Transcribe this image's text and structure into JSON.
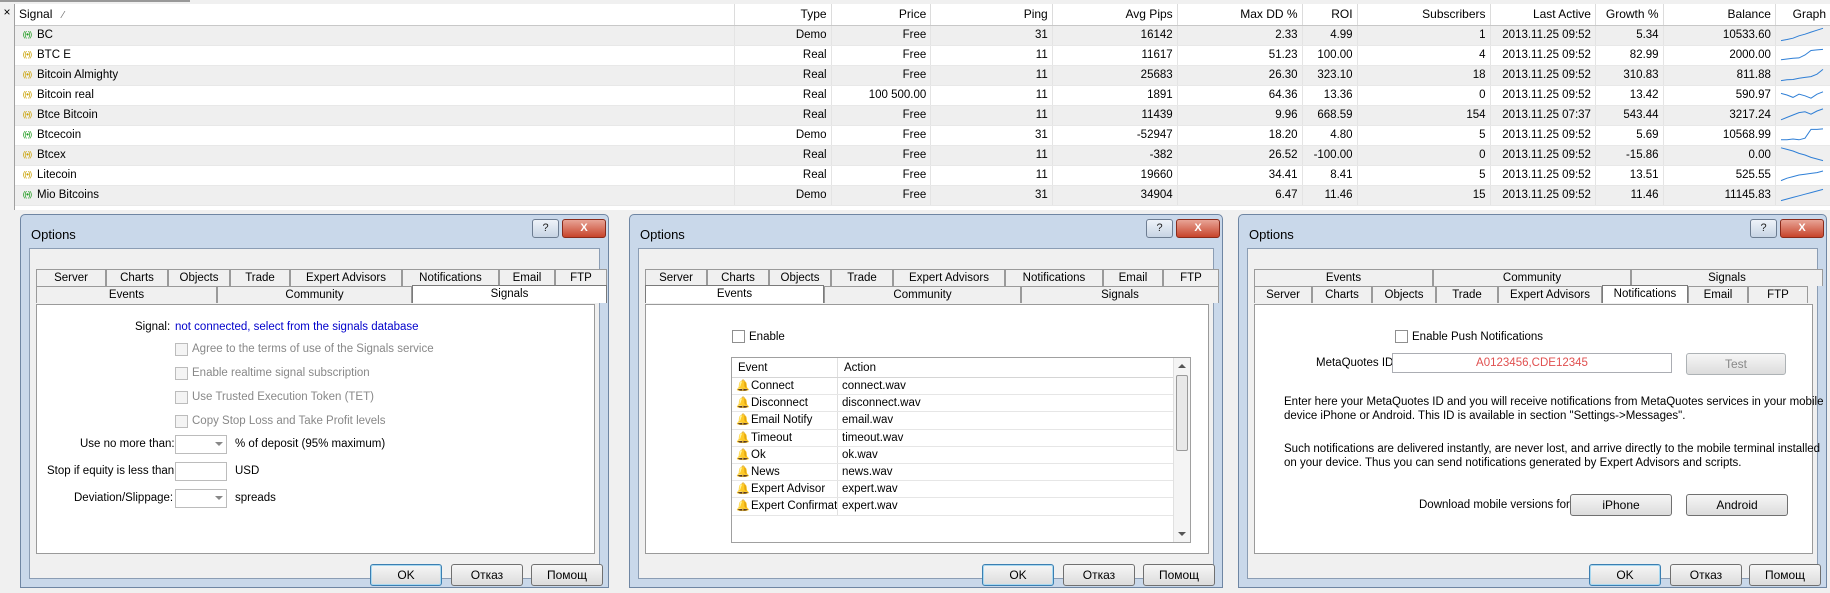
{
  "topbar": {
    "close_glyph": "×"
  },
  "table": {
    "sort_glyph": "⁄",
    "columns": [
      "Signal",
      "Type",
      "Price",
      "Ping",
      "Avg Pips",
      "Max DD %",
      "ROI",
      "Subscribers",
      "Last Active",
      "Growth %",
      "Balance",
      "Graph"
    ],
    "rows": [
      {
        "status": "green",
        "name": "BC",
        "type": "Demo",
        "price": "Free",
        "ping": "31",
        "avg_pips": "16142",
        "max_dd": "2.33",
        "roi": "4.99",
        "subs": "1",
        "last_active": "2013.11.25 09:52",
        "growth": "5.34",
        "balance": "10533.60",
        "trend": [
          0.15,
          0.22,
          0.3,
          0.45,
          0.55,
          0.68,
          0.8,
          0.92
        ]
      },
      {
        "status": "yellow",
        "name": "BTC E",
        "type": "Real",
        "price": "Free",
        "ping": "11",
        "avg_pips": "11617",
        "max_dd": "51.23",
        "roi": "100.00",
        "subs": "4",
        "last_active": "2013.11.25 09:52",
        "growth": "82.99",
        "balance": "2000.00",
        "trend": [
          0.2,
          0.25,
          0.3,
          0.32,
          0.5,
          0.78,
          0.82,
          0.85
        ]
      },
      {
        "status": "yellow",
        "name": "Bitcoin Almighty",
        "type": "Real",
        "price": "Free",
        "ping": "11",
        "avg_pips": "25683",
        "max_dd": "26.30",
        "roi": "323.10",
        "subs": "18",
        "last_active": "2013.11.25 09:52",
        "growth": "310.83",
        "balance": "811.88",
        "trend": [
          0.15,
          0.2,
          0.22,
          0.3,
          0.35,
          0.4,
          0.55,
          0.85
        ]
      },
      {
        "status": "yellow",
        "name": "Bitcoin real",
        "type": "Real",
        "price": "100 500.00",
        "ping": "11",
        "avg_pips": "1891",
        "max_dd": "64.36",
        "roi": "13.36",
        "subs": "0",
        "last_active": "2013.11.25 09:52",
        "growth": "13.42",
        "balance": "590.97",
        "trend": [
          0.6,
          0.5,
          0.35,
          0.55,
          0.45,
          0.3,
          0.55,
          0.7
        ]
      },
      {
        "status": "yellow",
        "name": "Btce Bitcoin",
        "type": "Real",
        "price": "Free",
        "ping": "11",
        "avg_pips": "11439",
        "max_dd": "9.96",
        "roi": "668.59",
        "subs": "154",
        "last_active": "2013.11.25 07:37",
        "growth": "543.44",
        "balance": "3217.24",
        "trend": [
          0.2,
          0.35,
          0.5,
          0.65,
          0.7,
          0.55,
          0.75,
          0.88
        ]
      },
      {
        "status": "green",
        "name": "Btcecoin",
        "type": "Demo",
        "price": "Free",
        "ping": "31",
        "avg_pips": "-52947",
        "max_dd": "18.20",
        "roi": "4.80",
        "subs": "5",
        "last_active": "2013.11.25 09:52",
        "growth": "5.69",
        "balance": "10568.99",
        "trend": [
          0.2,
          0.2,
          0.25,
          0.2,
          0.3,
          0.85,
          0.85,
          0.88
        ]
      },
      {
        "status": "yellow",
        "name": "Btcex",
        "type": "Real",
        "price": "Free",
        "ping": "11",
        "avg_pips": "-382",
        "max_dd": "26.52",
        "roi": "-100.00",
        "subs": "0",
        "last_active": "2013.11.25 09:52",
        "growth": "-15.86",
        "balance": "0.00",
        "trend": [
          0.95,
          0.85,
          0.75,
          0.6,
          0.5,
          0.35,
          0.25,
          0.15
        ]
      },
      {
        "status": "yellow",
        "name": "Litecoin",
        "type": "Real",
        "price": "Free",
        "ping": "11",
        "avg_pips": "19660",
        "max_dd": "34.41",
        "roi": "8.41",
        "subs": "5",
        "last_active": "2013.11.25 09:52",
        "growth": "13.51",
        "balance": "525.55",
        "trend": [
          0.15,
          0.3,
          0.4,
          0.5,
          0.55,
          0.6,
          0.65,
          0.75
        ]
      },
      {
        "status": "green",
        "name": "Mio Bitcoins",
        "type": "Demo",
        "price": "Free",
        "ping": "31",
        "avg_pips": "34904",
        "max_dd": "6.47",
        "roi": "11.46",
        "subs": "15",
        "last_active": "2013.11.25 09:52",
        "growth": "11.46",
        "balance": "11145.83",
        "trend": [
          0.15,
          0.25,
          0.35,
          0.45,
          0.55,
          0.65,
          0.75,
          0.85
        ]
      }
    ]
  },
  "dialog": {
    "title": "Options",
    "help_glyph": "?",
    "close_glyph": "X",
    "ok": "OK",
    "cancel": "Отказ",
    "help": "Помощ",
    "tabs": {
      "server": "Server",
      "charts": "Charts",
      "objects": "Objects",
      "trade": "Trade",
      "expert_advisors": "Expert Advisors",
      "notifications": "Notifications",
      "email": "Email",
      "ftp": "FTP",
      "events": "Events",
      "community": "Community",
      "signals": "Signals"
    }
  },
  "signals_panel": {
    "signal_label": "Signal:",
    "signal_value": "not connected, select from the signals database",
    "agree": "Agree to the terms of use of the Signals service",
    "realtime": "Enable realtime signal subscription",
    "tet": "Use Trusted Execution Token (TET)",
    "copy_sl_tp": "Copy Stop Loss and Take Profit levels",
    "use_no_more": "Use no more than:",
    "deposit_suffix": "% of deposit (95% maximum)",
    "stop_equity": "Stop if equity is less than:",
    "usd": "USD",
    "deviation": "Deviation/Slippage:",
    "spreads": "spreads"
  },
  "events_panel": {
    "enable": "Enable",
    "col_event": "Event",
    "col_action": "Action",
    "events": [
      {
        "event": "Connect",
        "action": "connect.wav",
        "icon": "bell-icon"
      },
      {
        "event": "Disconnect",
        "action": "disconnect.wav",
        "icon": "bell-icon"
      },
      {
        "event": "Email Notify",
        "action": "email.wav",
        "icon": "bell-icon"
      },
      {
        "event": "Timeout",
        "action": "timeout.wav",
        "icon": "bell-icon"
      },
      {
        "event": "Ok",
        "action": "ok.wav",
        "icon": "bell-icon"
      },
      {
        "event": "News",
        "action": "news.wav",
        "icon": "bell-muted-icon"
      },
      {
        "event": "Expert Advisor",
        "action": "expert.wav",
        "icon": "bell-icon"
      },
      {
        "event": "Expert Confirmation",
        "action": "expert.wav",
        "icon": "bell-icon"
      }
    ]
  },
  "notifications_panel": {
    "enable_push": "Enable Push Notifications",
    "metaquotes_label": "MetaQuotes ID",
    "metaquotes_placeholder": "A0123456,CDE12345",
    "test": "Test",
    "info1_line1": "Enter here your MetaQuotes ID and you will receive notifications from MetaQuotes services in your mobile",
    "info1_line2": "device iPhone or Android. This ID is available in section \"Settings->Messages\".",
    "info2_line1": "Such notifications are delivered instantly, are never lost, and arrive directly to the mobile terminal installed",
    "info2_line2": "on your device. Thus you can send notifications generated by Expert Advisors and scripts.",
    "download_label": "Download mobile versions for:",
    "iphone": "iPhone",
    "android": "Android"
  },
  "colors": {
    "trend_line": "#2f7fd6",
    "signal_link": "#0000cc",
    "placeholder": "#e05050",
    "close_red": "#c7442b"
  }
}
